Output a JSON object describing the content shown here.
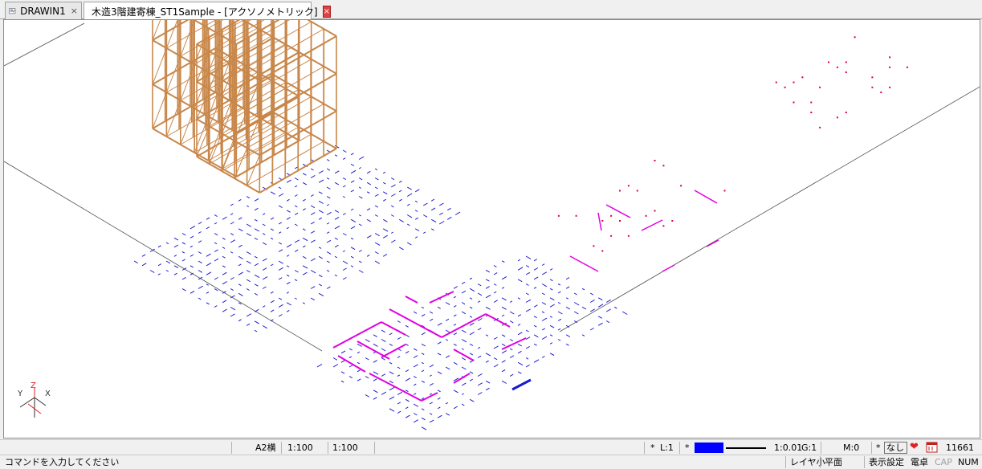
{
  "tabs": [
    {
      "label": "DRAWIN1",
      "close": "×"
    },
    {
      "label": "木造3階建寄棟_ST1Sample - [アクソノメトリック]",
      "close": "×"
    }
  ],
  "axis_labels": {
    "z": "Z",
    "y": "Y",
    "x": "X"
  },
  "colors": {
    "frame": "#c8874a",
    "grid": "#1a1ad0",
    "walls": "#e000e0",
    "points": "#e0003a",
    "axis_red": "#e02020",
    "axis_dark": "#303030"
  },
  "status_top": {
    "paper": "A2横",
    "scale1": "1:100",
    "scale2": "1:100",
    "star1": "*",
    "layer": "L:1",
    "star2": "*",
    "pen_color": "#0000ff",
    "ratio": "1:0.01",
    "group": "G:1",
    "mode": "M:0",
    "star3": "*",
    "none": "なし",
    "count": "11661"
  },
  "status_bottom": {
    "command_prompt": "コマンドを入力してください",
    "layer_small": "レイヤ小",
    "plane": "平面",
    "display_settings": "表示設定",
    "calculator": "電卓",
    "caps": "CAP",
    "num": "NUM"
  }
}
